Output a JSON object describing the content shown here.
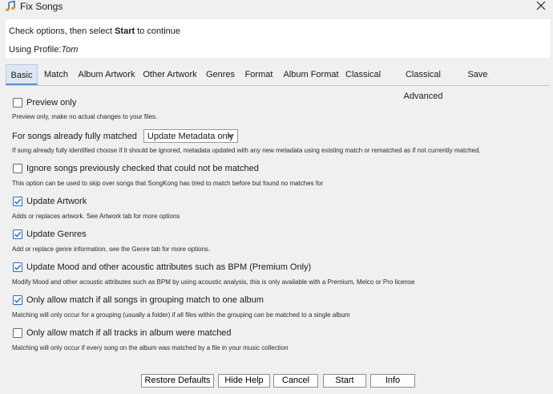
{
  "window": {
    "title": "Fix Songs"
  },
  "header": {
    "instruction_pre": "Check options, then select ",
    "instruction_bold": "Start",
    "instruction_post": " to continue",
    "profile_label": "Using Profile:",
    "profile_name": "Tom"
  },
  "tabs": [
    {
      "label": "Basic",
      "active": true
    },
    {
      "label": "Match"
    },
    {
      "label": "Album Artwork"
    },
    {
      "label": "Other Artwork"
    },
    {
      "label": "Genres"
    },
    {
      "label": "Format"
    },
    {
      "label": "Album Format"
    },
    {
      "label": "Classical"
    },
    {
      "label": "Classical Advanced"
    },
    {
      "label": "Save"
    }
  ],
  "options": {
    "preview": {
      "label": "Preview only",
      "checked": false,
      "help": "Preview only, make no actual changes to your files."
    },
    "already_matched": {
      "label": "For songs already fully matched",
      "selected": "Update Metadata only",
      "help": "If song already fully identified choose if it should be ignored, metadata updated with any new metadata using existing match or rematched as if not currently matched."
    },
    "ignore_previous": {
      "label": "Ignore songs previously checked that could not be matched",
      "checked": false,
      "help": "This option can be used to skip over songs that SongKong has tried to match before but found no matches for"
    },
    "update_artwork": {
      "label": "Update Artwork",
      "checked": true,
      "help": "Adds or replaces artwork. See Artwork tab for more options"
    },
    "update_genres": {
      "label": "Update Genres",
      "checked": true,
      "help": "Add or replace genre information, see the Genre tab for more options."
    },
    "update_mood": {
      "label": "Update Mood and other acoustic attributes such as BPM (Premium Only)",
      "checked": true,
      "help": "Modify Mood and other acoustic attributes such as BPM by using acoustic analysis, this is only available with a Premium, Melco or Pro license"
    },
    "grouping_match": {
      "label": "Only allow match if all songs in grouping match to one album",
      "checked": true,
      "help": "Matching will only occur for a grouping (usually a folder) if all files within the grouping can be matched to a single album"
    },
    "all_tracks": {
      "label": "Only allow match if all tracks in album were matched",
      "checked": false,
      "help": "Matching will only occur if every song on the album was matched by a file in your music collection"
    }
  },
  "buttons": {
    "restore": "Restore Defaults",
    "hide_help": "Hide Help",
    "cancel": "Cancel",
    "start": "Start",
    "info": "Info"
  },
  "colors": {
    "accent": "#2d6bc0",
    "tab_active_bg": "#dde7f3",
    "header_bg": "#ffffff",
    "window_bg": "#f0f0f0"
  },
  "icons": {
    "app": "music-note-icon",
    "close": "close-icon",
    "checkbox": "checkmark-icon",
    "dropdown": "chevron-down-icon"
  }
}
